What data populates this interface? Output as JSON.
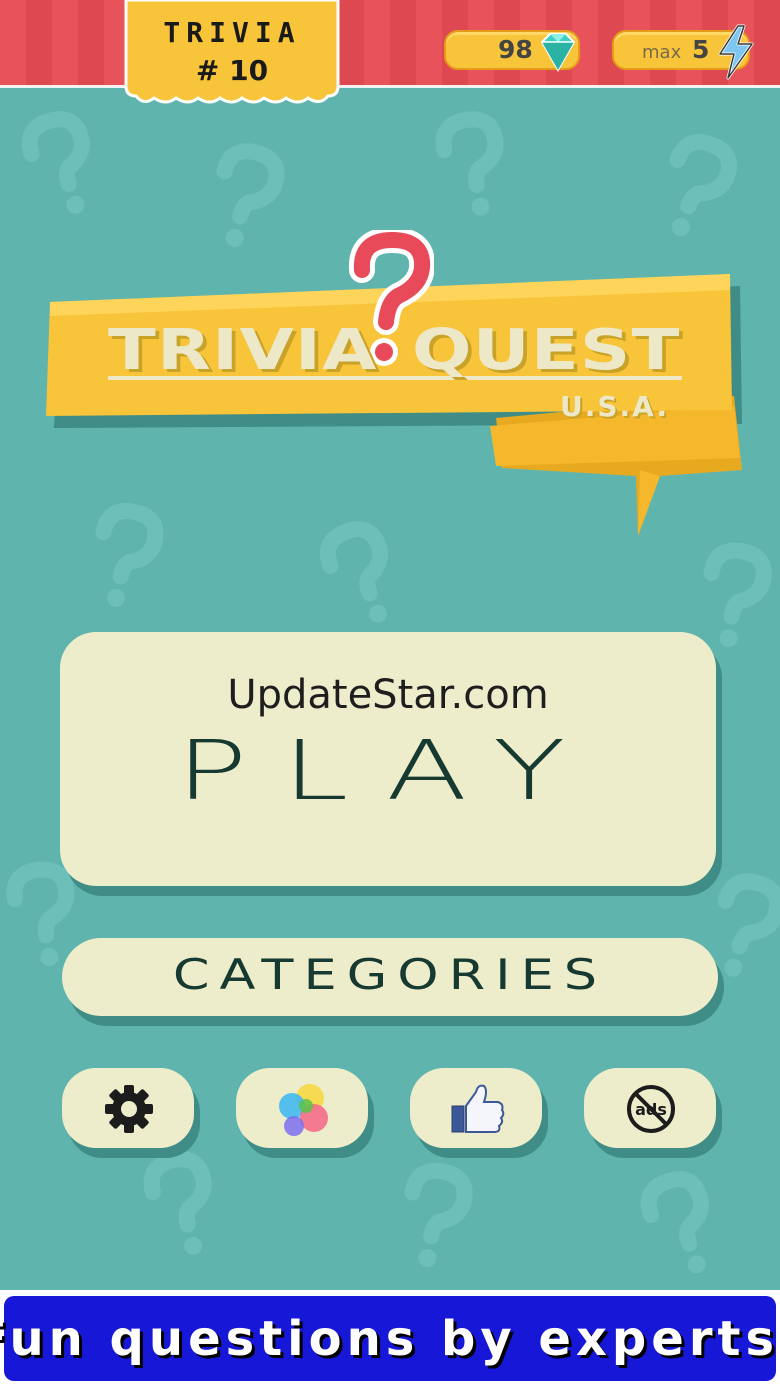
{
  "colors": {
    "background": "#5fb5ae",
    "top_bar": "#e8525a",
    "accent_yellow": "#f8c43a",
    "button_cream": "#eeedcb",
    "button_shadow": "#3f8d86",
    "question_mark": "#e84a5a",
    "promo_blue": "#1717d8"
  },
  "header": {
    "level_title": "TRIVIA",
    "level_number": "# 10",
    "gems": {
      "value": "98",
      "icon": "diamond-icon"
    },
    "energy": {
      "label": "max",
      "value": "5",
      "icon": "lightning-bolt-icon"
    }
  },
  "logo": {
    "word1": "TRIVIA",
    "word2": "QUEST",
    "subtitle": "U.S.A.",
    "icon": "question-mark-icon"
  },
  "buttons": {
    "watermark": "UpdateStar.com",
    "play": "PLAY",
    "categories": "CATEGORIES",
    "icons": [
      "gear-icon",
      "game-center-icon",
      "thumbs-up-icon",
      "no-ads-icon"
    ]
  },
  "promo": {
    "text": "Fun questions by experts!"
  }
}
